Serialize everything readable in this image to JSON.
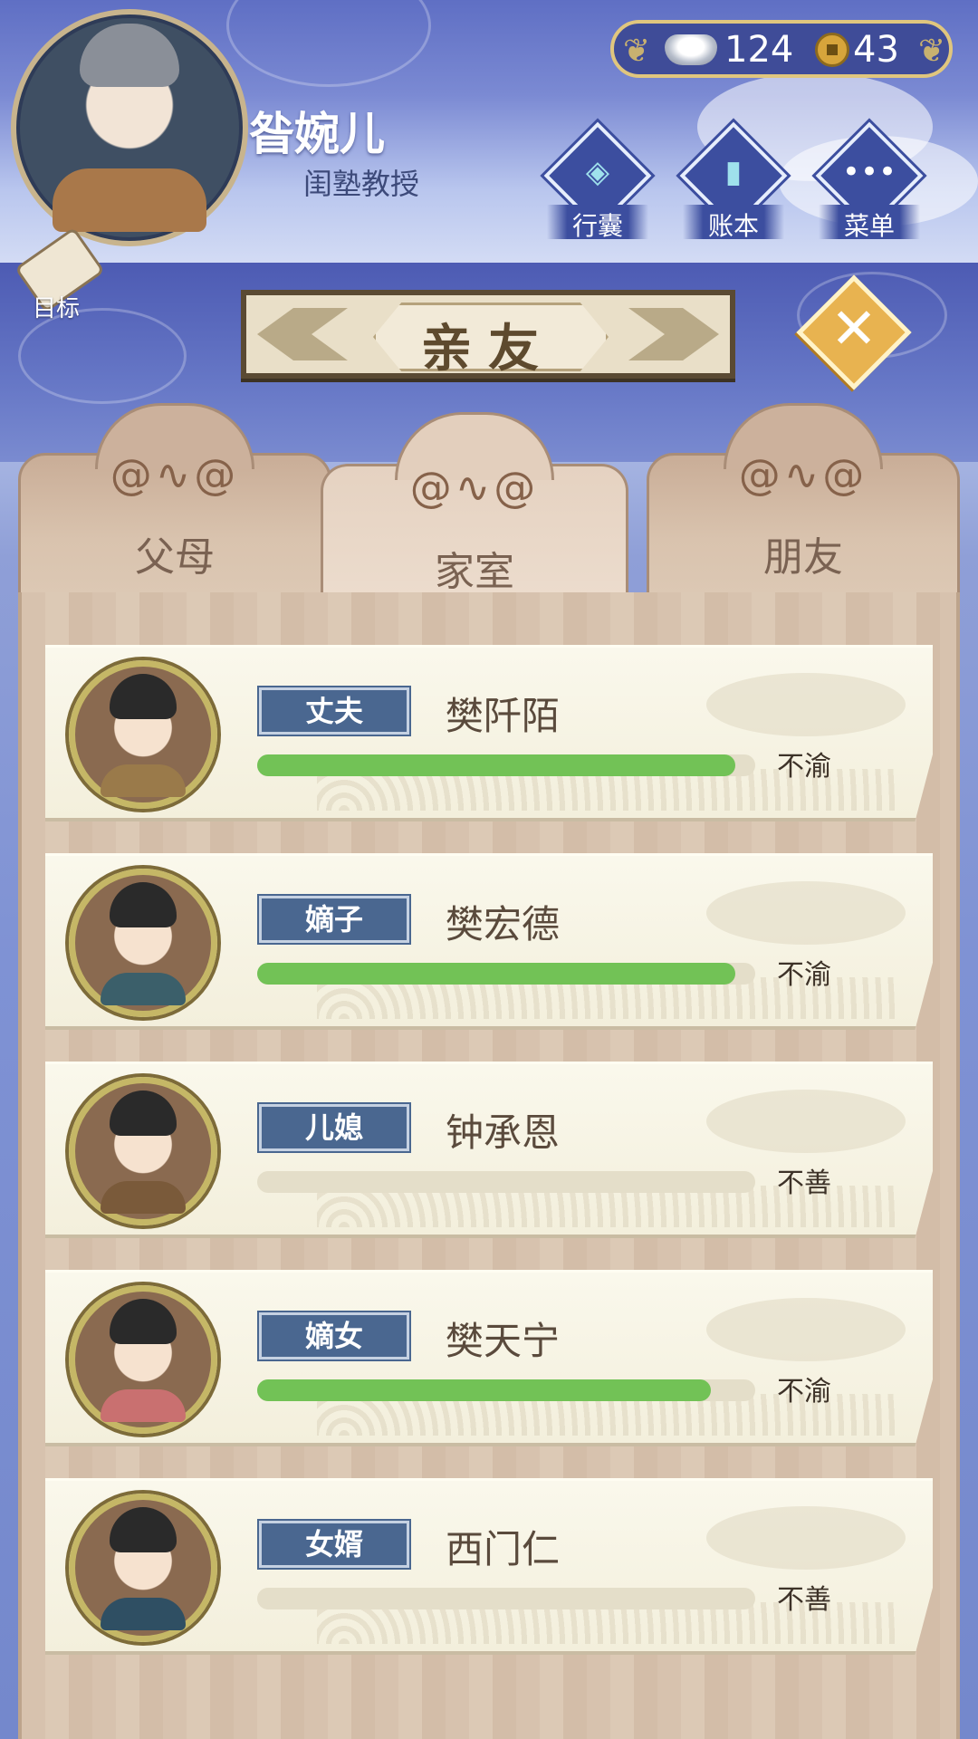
{
  "player": {
    "name": "昝婉儿",
    "title": "闺塾教授"
  },
  "goal": {
    "label": "目标",
    "icon": "scroll-icon"
  },
  "currency": {
    "silver": "124",
    "silver_icon": "silver-ingot-icon",
    "coin": "43",
    "coin_icon": "copper-coin-icon"
  },
  "menu_buttons": [
    {
      "label": "行囊",
      "icon": "bag-icon"
    },
    {
      "label": "账本",
      "icon": "ledger-icon"
    },
    {
      "label": "菜单",
      "icon": "more-icon"
    }
  ],
  "dialog": {
    "title": "亲友",
    "close_icon": "close-icon"
  },
  "tabs": [
    {
      "label": "父母",
      "active": false
    },
    {
      "label": "家室",
      "active": true
    },
    {
      "label": "朋友",
      "active": false
    }
  ],
  "relatives": [
    {
      "role": "丈夫",
      "name": "樊阡陌",
      "mood": "不渝",
      "affinity": 0.96,
      "robe_color": "#9a7a4a"
    },
    {
      "role": "嫡子",
      "name": "樊宏德",
      "mood": "不渝",
      "affinity": 0.96,
      "robe_color": "#3b5f6a"
    },
    {
      "role": "儿媳",
      "name": "钟承恩",
      "mood": "不善",
      "affinity": 0.0,
      "robe_color": "#7a5a3a"
    },
    {
      "role": "嫡女",
      "name": "樊天宁",
      "mood": "不渝",
      "affinity": 0.91,
      "robe_color": "#c97070"
    },
    {
      "role": "女婿",
      "name": "西门仁",
      "mood": "不善",
      "affinity": 0.0,
      "robe_color": "#2f4f63"
    }
  ],
  "colors": {
    "bar_fill": "#72c256",
    "bar_track": "#e4dec9",
    "role_tag": "#4a6790",
    "close_button": "#e8b350"
  }
}
